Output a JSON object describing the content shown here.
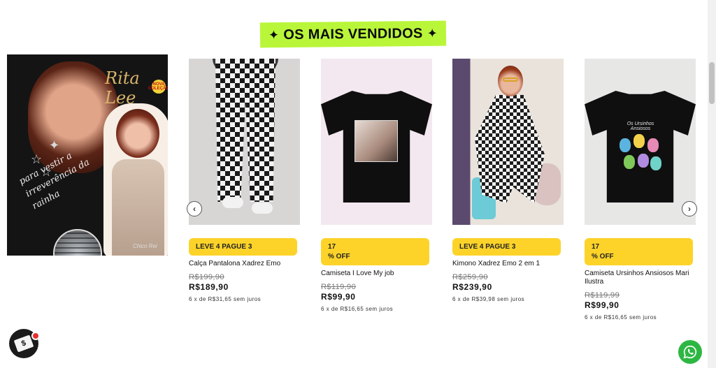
{
  "section": {
    "title": "OS MAIS VENDIDOS",
    "spark_glyph": "✦"
  },
  "promo_banner": {
    "title": "Rita Lee",
    "badge_text": "NOVA COLEÇÃO",
    "script_text": "para vestir a irreverência da rainha",
    "signature": "Chico Rei"
  },
  "products": [
    {
      "badge_line1": "LEVE 4 PAGUE 3",
      "badge_line2": "",
      "name": "Calça Pantalona Xadrez Emo",
      "old_price": "R$199,90",
      "price": "R$189,90",
      "installments": "6 x de R$31,65 sem juros"
    },
    {
      "badge_line1": "17",
      "badge_line2": "% OFF",
      "name": "Camiseta I Love My job",
      "old_price": "R$119,90",
      "price": "R$99,90",
      "installments": "6 x de R$16,65 sem juros"
    },
    {
      "badge_line1": "LEVE 4 PAGUE 3",
      "badge_line2": "",
      "name": "Kimono Xadrez Emo 2 em 1",
      "old_price": "R$259,90",
      "price": "R$239,90",
      "installments": "6 x de R$39,98 sem juros"
    },
    {
      "badge_line1": "17",
      "badge_line2": "% OFF",
      "name": "Camiseta Ursinhos Ansiosos Mari Ilustra",
      "old_price": "R$119,99",
      "price": "R$99,90",
      "installments": "6 x de R$16,65 sem juros"
    }
  ],
  "carousel": {
    "prev_glyph": "‹",
    "next_glyph": "›"
  },
  "tee_print": {
    "bears_title": "Os Ursinhos Ansiosos"
  },
  "floating": {
    "left_widget_glyph": "$",
    "whatsapp_icon": "whatsapp-icon"
  },
  "colors": {
    "title_bg": "#b9f63a",
    "badge_bg": "#fdd32a",
    "whatsapp": "#2db742"
  }
}
